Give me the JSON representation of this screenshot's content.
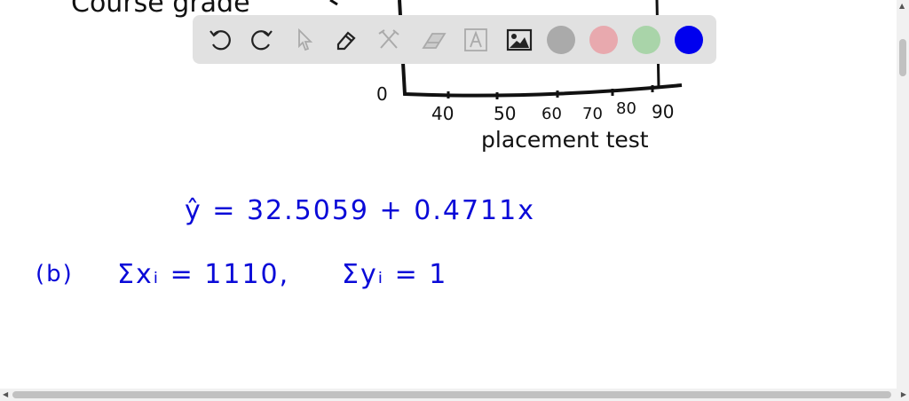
{
  "whiteboard": {
    "y_axis_label": "Course grade",
    "y_tick_zero": "0",
    "x_ticks": [
      "40",
      "50",
      "60",
      "70",
      "80",
      "90"
    ],
    "x_axis_label": "placement test",
    "regression_equation": "ŷ = 32.5059 + 0.4711x",
    "part_b_label": "(b)",
    "sum_x": "Σxᵢ = 1110,",
    "sum_y": "Σyᵢ = 1"
  },
  "toolbar": {
    "tools": [
      "undo",
      "redo",
      "select",
      "pen",
      "tools",
      "eraser",
      "text",
      "image"
    ],
    "colors": [
      "#aaaaaa",
      "#e8a9ae",
      "#a9d4a9",
      "#0000ee"
    ],
    "active_color": "#0000ee"
  }
}
